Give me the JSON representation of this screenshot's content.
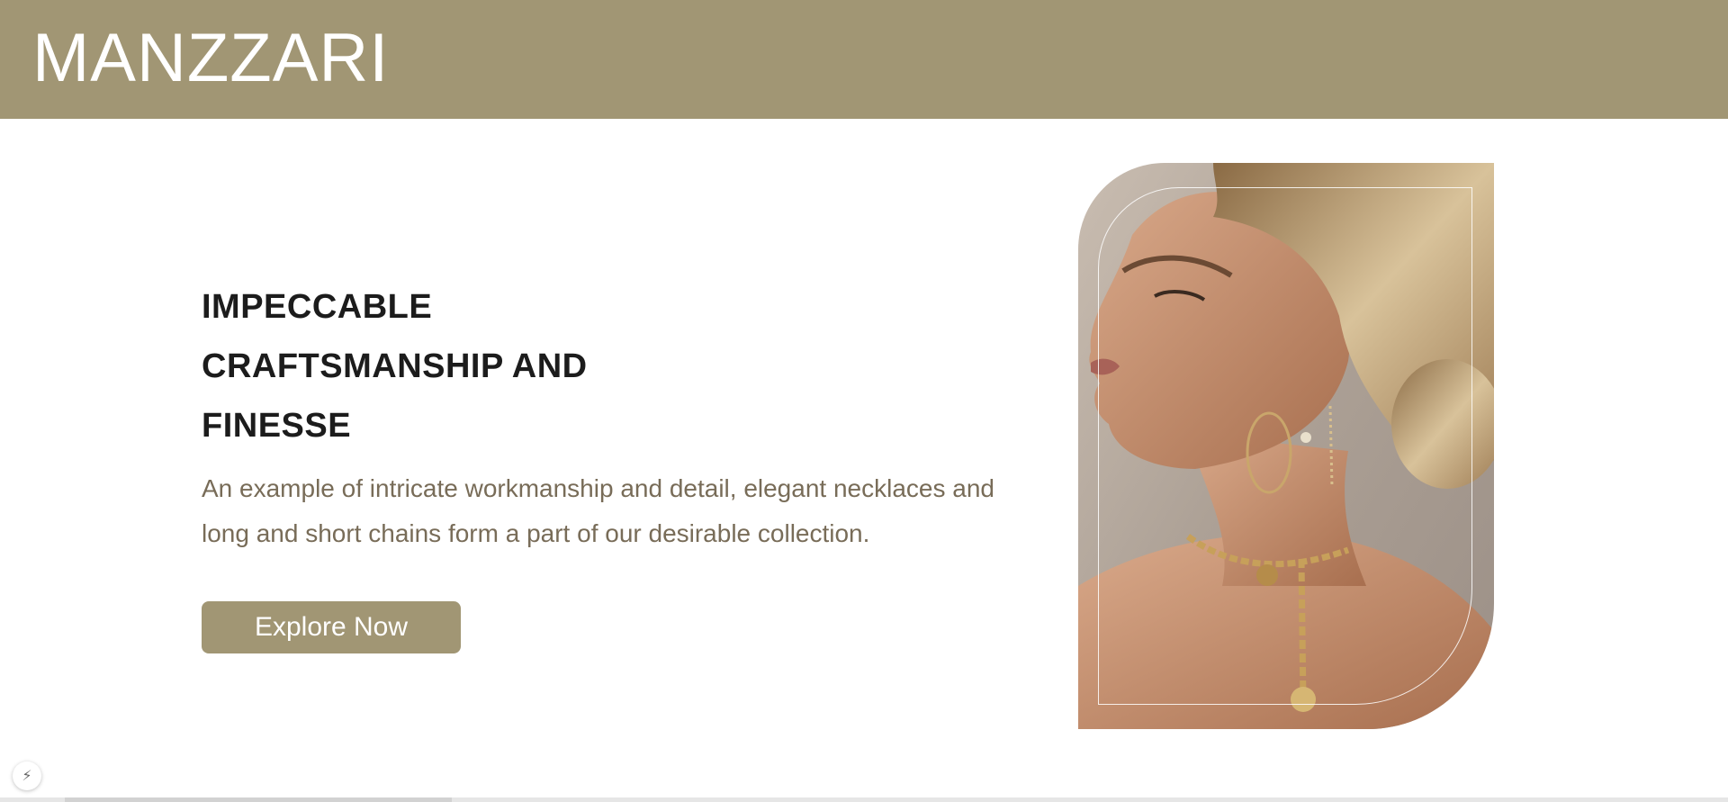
{
  "header": {
    "brand": "MANZZARI",
    "background_color": "#a19674"
  },
  "hero": {
    "headline_lines": [
      "IMPECCABLE",
      "CRAFTSMANSHIP AND",
      "FINESSE"
    ],
    "description": "An example of intricate workmanship and detail, elegant necklaces and long and short chains form a part of our desirable collection.",
    "cta_label": "Explore Now",
    "accent_color": "#a19674",
    "description_color": "#786c58"
  },
  "image": {
    "subject": "model-wearing-gold-necklace-and-earrings",
    "icon": "photo"
  },
  "corner_widget": {
    "icon": "lightning-icon"
  }
}
